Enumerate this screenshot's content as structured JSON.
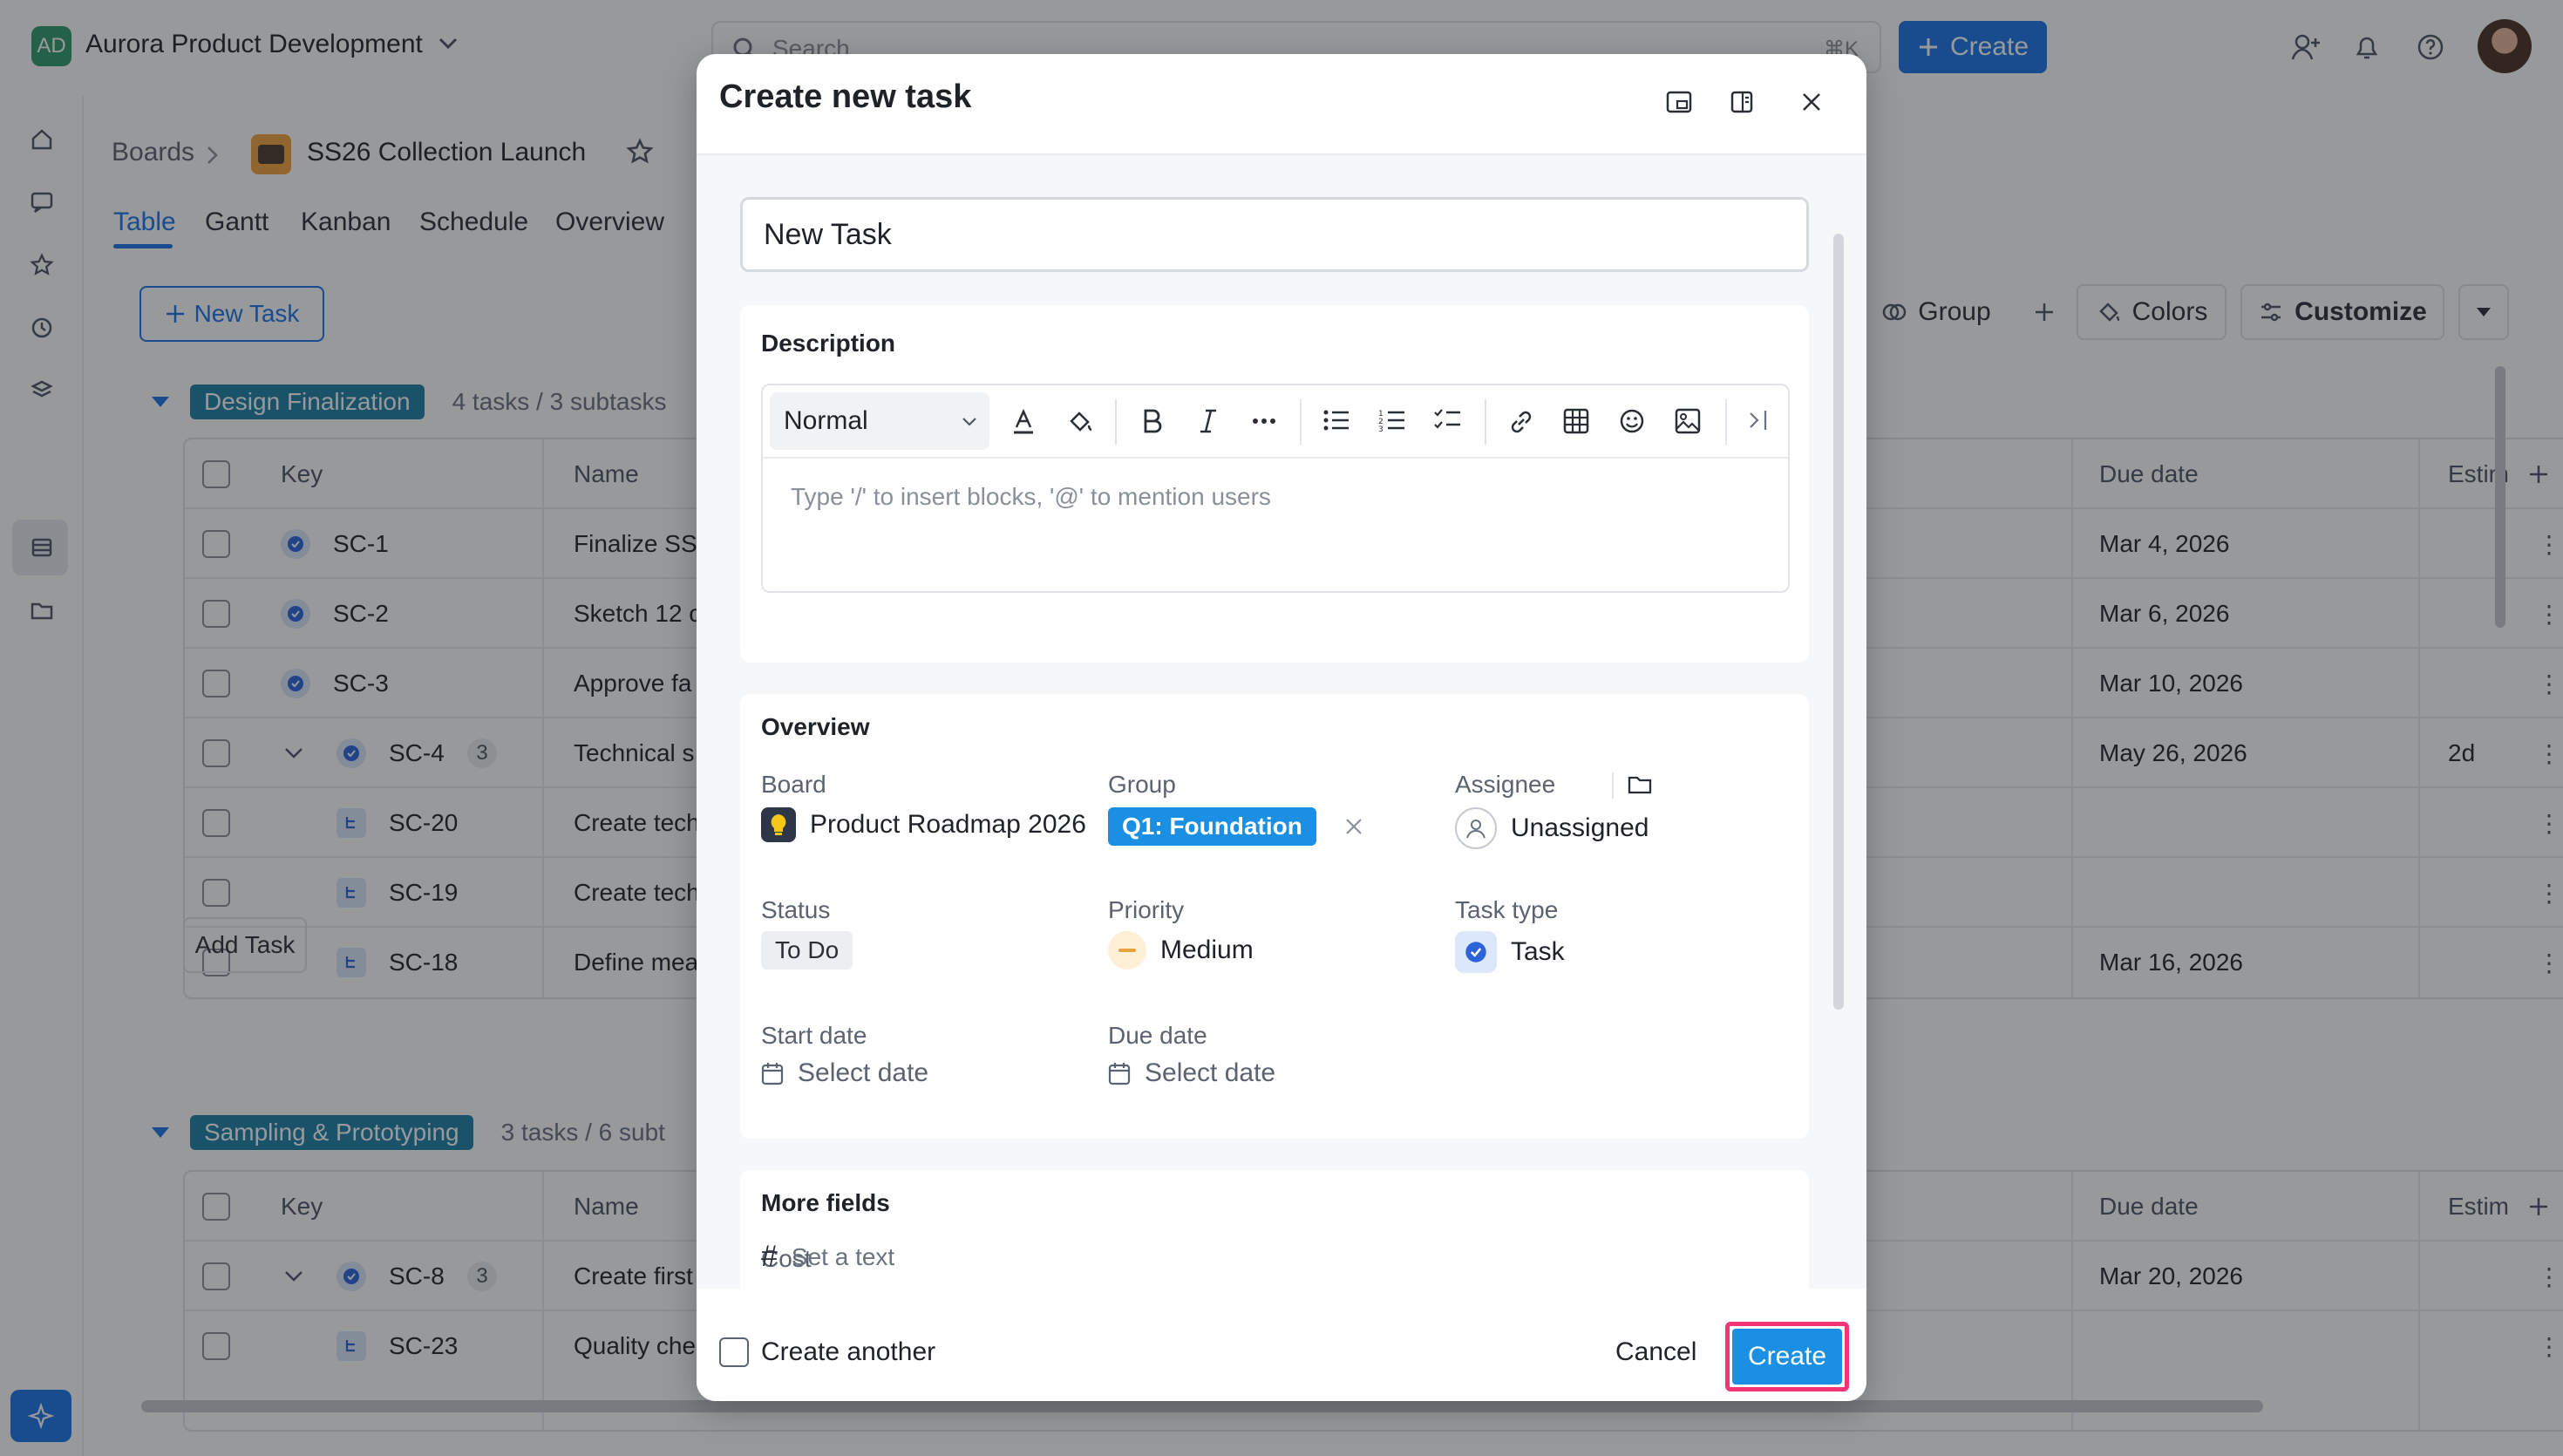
{
  "workspace": {
    "initials": "AD",
    "name": "Aurora Product Development"
  },
  "search": {
    "placeholder": "Search",
    "shortcut": "⌘K"
  },
  "top": {
    "create_label": "Create"
  },
  "breadcrumb": {
    "boards": "Boards",
    "board": "SS26 Collection Launch"
  },
  "tabs": [
    "Table",
    "Gantt",
    "Kanban",
    "Schedule",
    "Overview"
  ],
  "toolbar": {
    "new_task": "New Task",
    "group": "Group",
    "colors": "Colors",
    "customize": "Customize"
  },
  "columns": {
    "key": "Key",
    "name": "Name",
    "due": "Due date",
    "estim": "Estim"
  },
  "groups": [
    {
      "name": "Design Finalization",
      "count": "4 tasks / 3 subtasks",
      "rows": [
        {
          "key": "SC-1",
          "name": "Finalize SS",
          "due": "Mar 4, 2026",
          "est": "",
          "kind": "task",
          "level": 0
        },
        {
          "key": "SC-2",
          "name": "Sketch 12 c",
          "due": "Mar 6, 2026",
          "est": "",
          "kind": "task",
          "level": 0
        },
        {
          "key": "SC-3",
          "name": "Approve fa",
          "due": "Mar 10, 2026",
          "est": "",
          "kind": "task",
          "level": 0
        },
        {
          "key": "SC-4",
          "name": "Technical s",
          "due": "May 26, 2026",
          "est": "2d",
          "kind": "task",
          "level": 0,
          "sub": "3"
        },
        {
          "key": "SC-20",
          "name": "Create tech",
          "due": "",
          "est": "",
          "kind": "subtask",
          "level": 1
        },
        {
          "key": "SC-19",
          "name": "Create tech",
          "due": "",
          "est": "",
          "kind": "subtask",
          "level": 1
        },
        {
          "key": "SC-18",
          "name": "Define mea",
          "due": "Mar 16, 2026",
          "est": "",
          "kind": "subtask",
          "level": 1
        }
      ]
    },
    {
      "name": "Sampling & Prototyping",
      "count": "3 tasks / 6 subt",
      "rows": [
        {
          "key": "SC-8",
          "name": "Create first",
          "due": "Mar 20, 2026",
          "est": "",
          "kind": "task",
          "level": 0,
          "sub": "3"
        },
        {
          "key": "SC-23",
          "name": "Quality che",
          "due": "",
          "est": "",
          "kind": "subtask",
          "level": 1
        }
      ]
    }
  ],
  "add_task": "Add Task",
  "modal": {
    "title": "Create new task",
    "task_name": "New Task",
    "description": {
      "title": "Description",
      "style": "Normal",
      "placeholder": "Type '/' to insert blocks, '@' to mention users"
    },
    "overview": {
      "title": "Overview",
      "board_label": "Board",
      "board_value": "Product Roadmap 2026",
      "group_label": "Group",
      "group_value": "Q1: Foundation",
      "assignee_label": "Assignee",
      "assignee_value": "Unassigned",
      "status_label": "Status",
      "status_value": "To Do",
      "priority_label": "Priority",
      "priority_value": "Medium",
      "tasktype_label": "Task type",
      "tasktype_value": "Task",
      "start_label": "Start date",
      "start_value": "Select date",
      "due_label": "Due date",
      "due_value": "Select date"
    },
    "more": {
      "title": "More fields",
      "cost_label": "Cost",
      "cost_placeholder": "Set a text"
    },
    "footer": {
      "create_another": "Create another",
      "cancel": "Cancel",
      "create": "Create"
    }
  },
  "colors": {
    "accent": "#1a73e8",
    "group_pill": "#1c7fa6",
    "highlight_ring": "#f23573"
  }
}
